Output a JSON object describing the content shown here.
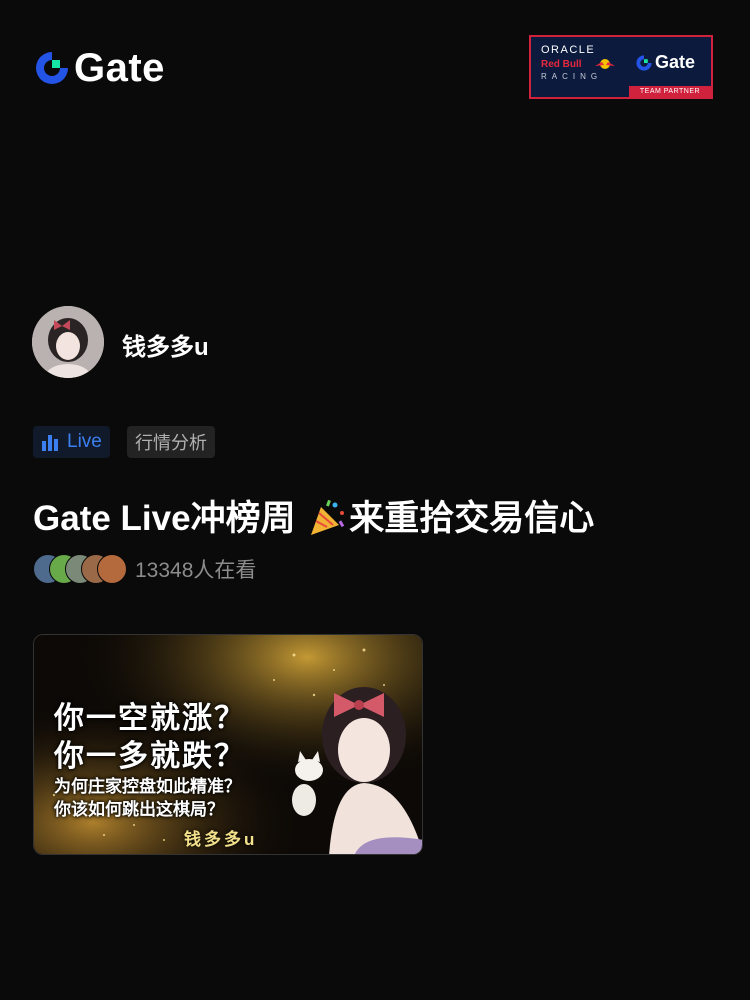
{
  "brand": {
    "name": "Gate",
    "accent": "#2354e6",
    "accent_green": "#17e5a4"
  },
  "partner_badge": {
    "oracle": "ORACLE",
    "redbull": "Red Bull",
    "racing": "RACING",
    "gate": "Gate",
    "team": "TEAM PARTNER"
  },
  "streamer": {
    "name": "钱多多u",
    "avatar_icon": "anime-girl-avatar"
  },
  "tags": {
    "live": "Live",
    "category": "行情分析"
  },
  "stream": {
    "title_part1": "Gate Live冲榜周 ",
    "title_emoji": "party-popper-icon",
    "title_part2": "来重拾交易信心",
    "viewers": "13348人在看"
  },
  "thumbnail": {
    "line1": "你一空就涨？",
    "line2": "你一多就跌？",
    "line3": "为何庄家控盘如此精准？",
    "line4": "你该如何跳出这棋局？",
    "signature": "钱多多u"
  }
}
